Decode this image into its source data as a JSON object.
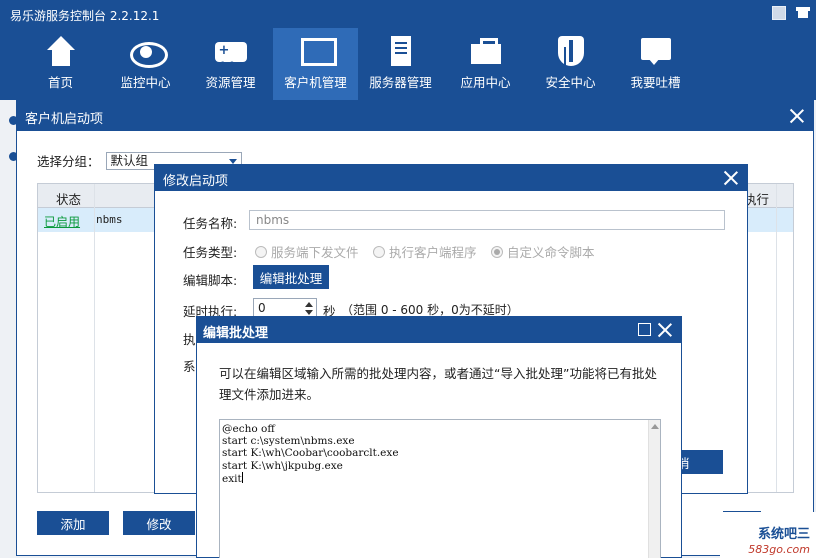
{
  "app": {
    "title": "易乐游服务控制台 2.2.12.1"
  },
  "nav": [
    {
      "label": "首页",
      "icon": "home-icon"
    },
    {
      "label": "监控中心",
      "icon": "eye-icon"
    },
    {
      "label": "资源管理",
      "icon": "gamepad-icon"
    },
    {
      "label": "客户机管理",
      "icon": "monitor-icon",
      "active": true
    },
    {
      "label": "服务器管理",
      "icon": "server-icon"
    },
    {
      "label": "应用中心",
      "icon": "toolbox-icon"
    },
    {
      "label": "安全中心",
      "icon": "shield-icon"
    },
    {
      "label": "我要吐槽",
      "icon": "chat-icon"
    }
  ],
  "startup_dialog": {
    "title": "客户机启动项",
    "group_label": "选择分组：",
    "group_value": "默认组",
    "columns": [
      "状态",
      "执行"
    ],
    "rows": [
      {
        "status": "已启用",
        "name": "nbms"
      }
    ],
    "add_button": "添加",
    "edit_button": "修改",
    "close_button_partial": "关"
  },
  "edit_dialog": {
    "title": "修改启动项",
    "task_name_label": "任务名称:",
    "task_name_value": "nbms",
    "task_type_label": "任务类型:",
    "task_types": [
      "服务端下发文件",
      "执行客户端程序",
      "自定义命令脚本"
    ],
    "script_label": "编辑脚本:",
    "script_button": "编辑批处理",
    "delay_label": "延时执行:",
    "delay_value": "0",
    "delay_unit": "秒",
    "delay_hint": "（范围 0 - 600 秒，0为不延时）",
    "hidden_label_1": "执",
    "hidden_label_2": "系",
    "cancel_partial": "消"
  },
  "batch_dialog": {
    "title": "编辑批处理",
    "description": "可以在编辑区域输入所需的批处理内容，或者通过“导入批处理”功能将已有批处理文件添加进来。",
    "script": "@echo off\nstart c:\\system\\nbms.exe\nstart K:\\wh\\Coobar\\coobarclt.exe\nstart K:\\wh\\jkpubg.exe\nexit"
  },
  "watermark": {
    "logo": "系统吧三",
    "url": "583go.com"
  }
}
